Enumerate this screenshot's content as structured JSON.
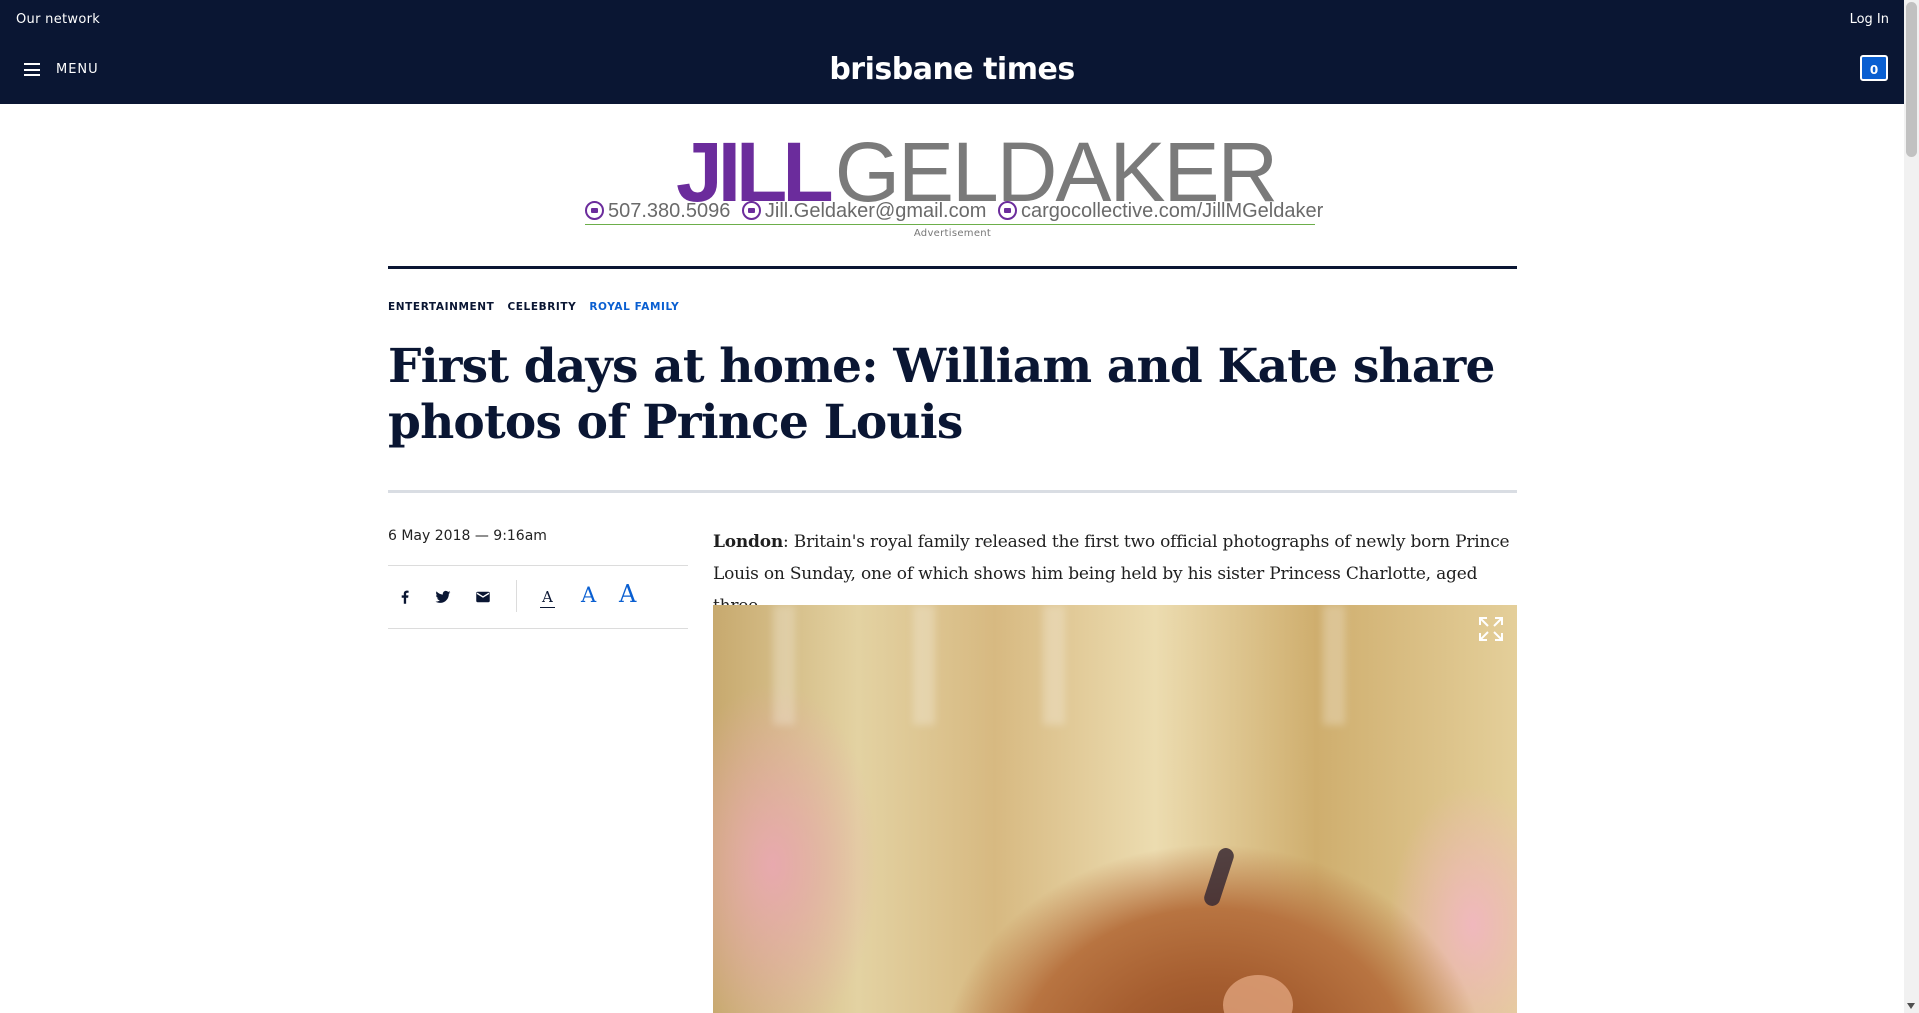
{
  "topbar": {
    "network": "Our network",
    "login": "Log In"
  },
  "masthead": {
    "menu": "MENU",
    "logo": "brisbane times",
    "cart_count": "0"
  },
  "ad": {
    "first_name": "JILL",
    "last_name": "GELDAKER",
    "phone": "507.380.5096",
    "email": "Jill.Geldaker@gmail.com",
    "website": "cargocollective.com/JillMGeldaker",
    "label": "Advertisement"
  },
  "categories": [
    "ENTERTAINMENT",
    "CELEBRITY",
    "ROYAL FAMILY"
  ],
  "article": {
    "headline": "First days at home: William and Kate share photos of Prince Louis",
    "date": "6 May 2018 — 9:16am",
    "dateline": "London",
    "lead": ": Britain's royal family released the first two official photographs of newly born Prince Louis on Sunday, one of which shows him being held by his sister Princess Charlotte, aged three."
  },
  "tools": {
    "font_small": "A",
    "font_mid": "A",
    "font_big": "A"
  },
  "icons": {
    "menu": "hamburger-icon",
    "facebook": "facebook-icon",
    "twitter": "twitter-icon",
    "email": "email-icon",
    "expand": "expand-icon"
  },
  "colors": {
    "navy": "#0a1633",
    "accent": "#0a5fd1",
    "ad_purple": "#6b2c9c"
  }
}
